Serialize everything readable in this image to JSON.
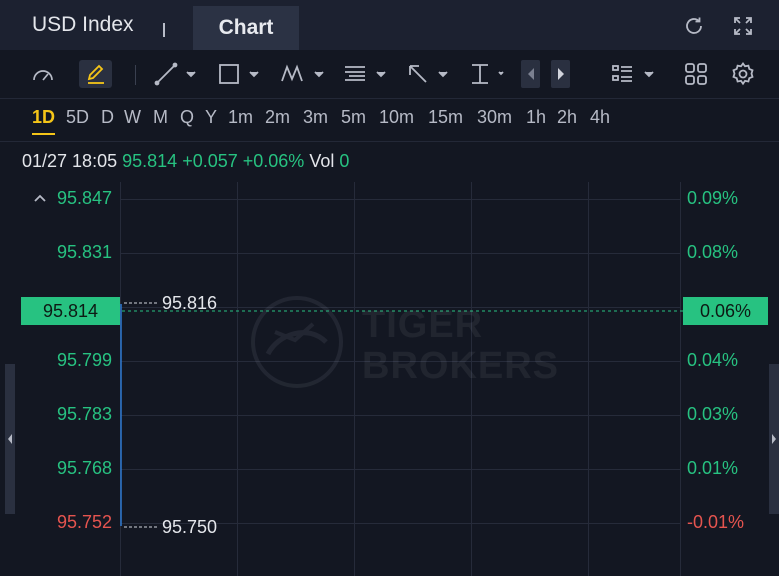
{
  "header": {
    "title": "USD Index",
    "separator": "|",
    "active_tab": "Chart"
  },
  "intervals": [
    "1D",
    "5D",
    "D",
    "W",
    "M",
    "Q",
    "Y",
    "1m",
    "2m",
    "3m",
    "5m",
    "10m",
    "15m",
    "30m",
    "1h",
    "2h",
    "4h"
  ],
  "active_interval": "1D",
  "quote": {
    "datetime": "01/27 18:05",
    "price": "95.814",
    "change": "+0.057",
    "change_pct": "+0.06%",
    "vol_label": "Vol",
    "vol_value": "0"
  },
  "chart": {
    "y_left": [
      "95.847",
      "95.831",
      "95.814",
      "95.799",
      "95.783",
      "95.768",
      "95.752"
    ],
    "y_right": [
      "0.09%",
      "0.08%",
      "0.06%",
      "0.04%",
      "0.03%",
      "0.01%",
      "-0.01%"
    ],
    "current_price": "95.814",
    "current_pct": "0.06%",
    "high_marker": "95.816",
    "low_marker": "95.750",
    "watermark_line1": "TIGER",
    "watermark_line2": "BROKERS"
  },
  "colors": {
    "up": "#27c281",
    "down": "#e5544f",
    "accent": "#f5c518",
    "background": "#131722"
  }
}
